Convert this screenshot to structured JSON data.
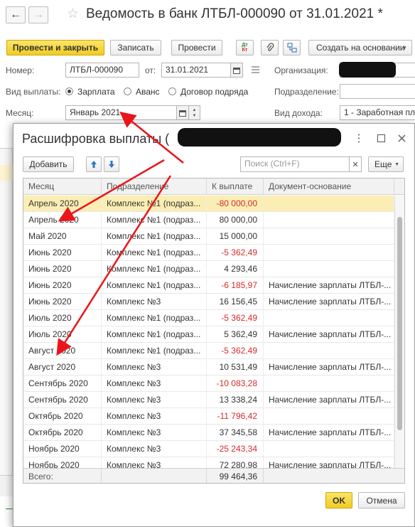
{
  "header": {
    "back_icon": "arrow-left-icon",
    "forward_icon": "arrow-right-icon",
    "favorite_icon": "star-icon",
    "title": "Ведомость в банк ЛТБЛ-000090 от 31.01.2021 *"
  },
  "toolbar": {
    "post_close_label": "Провести и закрыть",
    "save_label": "Записать",
    "post_label": "Провести",
    "dtkt_icon": "debit-credit-icon",
    "dtkt_text_top": "Дт",
    "dtkt_text_bottom": "Кт",
    "attach_icon": "paperclip-icon",
    "structure_icon": "structure-icon",
    "create_based_label": "Создать на основании"
  },
  "form": {
    "number_label": "Номер:",
    "number_value": "ЛТБЛ-000090",
    "date_label": "от:",
    "date_value": "31.01.2021",
    "org_label": "Организация:",
    "payment_type_label": "Вид выплаты:",
    "payment_options": [
      "Зарплата",
      "Аванс",
      "Договор подряда"
    ],
    "payment_selected": "Зарплата",
    "division_label": "Подразделение:",
    "month_label": "Месяц:",
    "month_value": "Январь 2021",
    "income_label": "Вид дохода:",
    "income_value": "1 - Заработная пла"
  },
  "dialog": {
    "title": "Расшифровка выплаты (",
    "title_suffix": "...",
    "add_label": "Добавить",
    "search_placeholder": "Поиск (Ctrl+F)",
    "more_label": "Еще",
    "columns": [
      "Месяц",
      "Подразделение",
      "К выплате",
      "Документ-основание"
    ],
    "rows": [
      {
        "month": "Апрель 2020",
        "division": "Комплекс №1 (подраз...",
        "amount": "-80 000,00",
        "negative": true,
        "basis": ""
      },
      {
        "month": "Апрель 2020",
        "division": "Комплекс №1 (подраз...",
        "amount": "80 000,00",
        "negative": false,
        "basis": ""
      },
      {
        "month": "Май 2020",
        "division": "Комплекс №1 (подраз...",
        "amount": "15 000,00",
        "negative": false,
        "basis": ""
      },
      {
        "month": "Июнь 2020",
        "division": "Комплекс №1 (подраз...",
        "amount": "-5 362,49",
        "negative": true,
        "basis": ""
      },
      {
        "month": "Июнь 2020",
        "division": "Комплекс №1 (подраз...",
        "amount": "4 293,46",
        "negative": false,
        "basis": ""
      },
      {
        "month": "Июнь 2020",
        "division": "Комплекс №1 (подраз...",
        "amount": "-6 185,97",
        "negative": true,
        "basis": "Начисление зарплаты ЛТБЛ-..."
      },
      {
        "month": "Июнь 2020",
        "division": "Комплекс №3",
        "amount": "16 156,45",
        "negative": false,
        "basis": "Начисление зарплаты ЛТБЛ-..."
      },
      {
        "month": "Июль 2020",
        "division": "Комплекс №1 (подраз...",
        "amount": "-5 362,49",
        "negative": true,
        "basis": ""
      },
      {
        "month": "Июль 2020",
        "division": "Комплекс №1 (подраз...",
        "amount": "5 362,49",
        "negative": false,
        "basis": "Начисление зарплаты ЛТБЛ-..."
      },
      {
        "month": "Август 2020",
        "division": "Комплекс №1 (подраз...",
        "amount": "-5 362,49",
        "negative": true,
        "basis": ""
      },
      {
        "month": "Август 2020",
        "division": "Комплекс №3",
        "amount": "10 531,49",
        "negative": false,
        "basis": "Начисление зарплаты ЛТБЛ-..."
      },
      {
        "month": "Сентябрь 2020",
        "division": "Комплекс №3",
        "amount": "-10 083,28",
        "negative": true,
        "basis": ""
      },
      {
        "month": "Сентябрь 2020",
        "division": "Комплекс №3",
        "amount": "13 338,24",
        "negative": false,
        "basis": "Начисление зарплаты ЛТБЛ-..."
      },
      {
        "month": "Октябрь 2020",
        "division": "Комплекс №3",
        "amount": "-11 796,42",
        "negative": true,
        "basis": ""
      },
      {
        "month": "Октябрь 2020",
        "division": "Комплекс №3",
        "amount": "37 345,58",
        "negative": false,
        "basis": "Начисление зарплаты ЛТБЛ-..."
      },
      {
        "month": "Ноябрь 2020",
        "division": "Комплекс №3",
        "amount": "-25 243,34",
        "negative": true,
        "basis": ""
      },
      {
        "month": "Ноябрь 2020",
        "division": "Комплекс №3",
        "amount": "72 280,98",
        "negative": false,
        "basis": "Начисление зарплаты ЛТБЛ-..."
      }
    ],
    "selected_row": 0,
    "total_label": "Всего:",
    "total_value": "99 464,36",
    "ok_label": "OK",
    "cancel_label": "Отмена"
  },
  "colors": {
    "primary_button": "#f2cc21",
    "negative_amount": "#d42b2b",
    "selected_row": "#fbeeb4",
    "annotation_arrow": "#e8161c"
  }
}
